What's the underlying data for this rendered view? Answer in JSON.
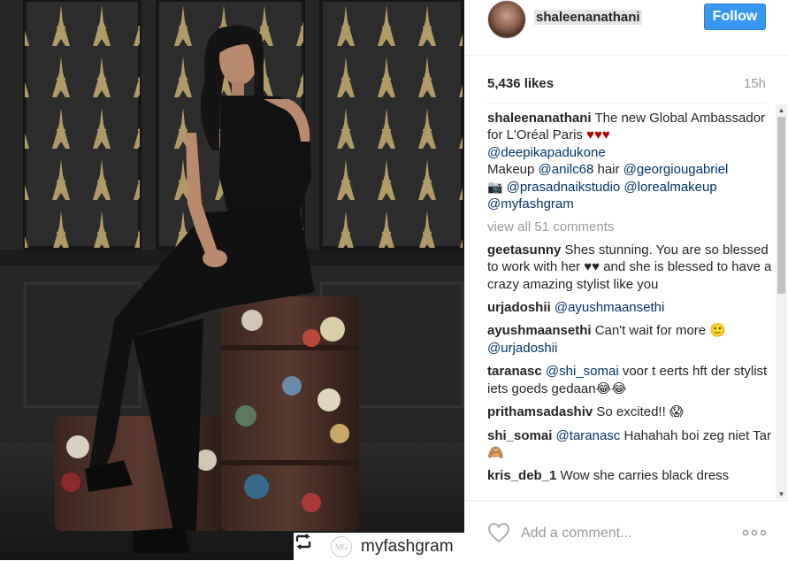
{
  "photo": {
    "repost": {
      "icon": "repost-icon",
      "logo_text": "MG",
      "handle": "myfashgram"
    }
  },
  "header": {
    "username": "shaleenanathani",
    "follow_label": "Follow"
  },
  "stats": {
    "likes": "5,436 likes",
    "time": "15h"
  },
  "caption": {
    "user": "shaleenanathani",
    "text": " The new Global Ambassador for L'Oréal Paris ",
    "hearts": "♥♥♥",
    "mention1": "@deepikapadukone",
    "makeup_label": "Makeup ",
    "mention2": "@anilc68",
    "hair_label": " hair ",
    "mention3": "@georgiougabriel",
    "camera": "📷",
    "mention4": "@prasadnaikstudio",
    "mention5": "@lorealmakeup",
    "mention6": "@myfashgram"
  },
  "view_all": "view all 51 comments",
  "comments": [
    {
      "user": "geetasunny",
      "text": " Shes stunning. You are so blessed to work with her ",
      "emoji": "♥♥",
      "text2": " and she is blessed to have a crazy amazing stylist like you"
    },
    {
      "user": "urjadoshii",
      "mention": "@ayushmaansethi"
    },
    {
      "user": "ayushmaansethi",
      "text": " Can't wait for more ",
      "emoji": "🙂",
      "mention": "@urjadoshii"
    },
    {
      "user": "taranasc",
      "mention": "@shi_somai",
      "text": " voor t eerts hft der stylist iets goeds gedaan",
      "emoji": "😂😂"
    },
    {
      "user": "prithamsadashiv",
      "text": " So excited!! ",
      "emoji": "😱"
    },
    {
      "user": "shi_somai",
      "mention": "@taranasc",
      "text": " Hahahah boi zeg niet Tar",
      "emoji": "🙈"
    },
    {
      "user": "kris_deb_1",
      "text": " Wow she carries black dress"
    }
  ],
  "add_comment": {
    "placeholder": "Add a comment...",
    "like_icon": "heart-outline-icon",
    "more_icon": "more-options-icon"
  },
  "colors": {
    "follow_button": "#3897f0",
    "mention": "#003569",
    "muted": "#999999"
  }
}
